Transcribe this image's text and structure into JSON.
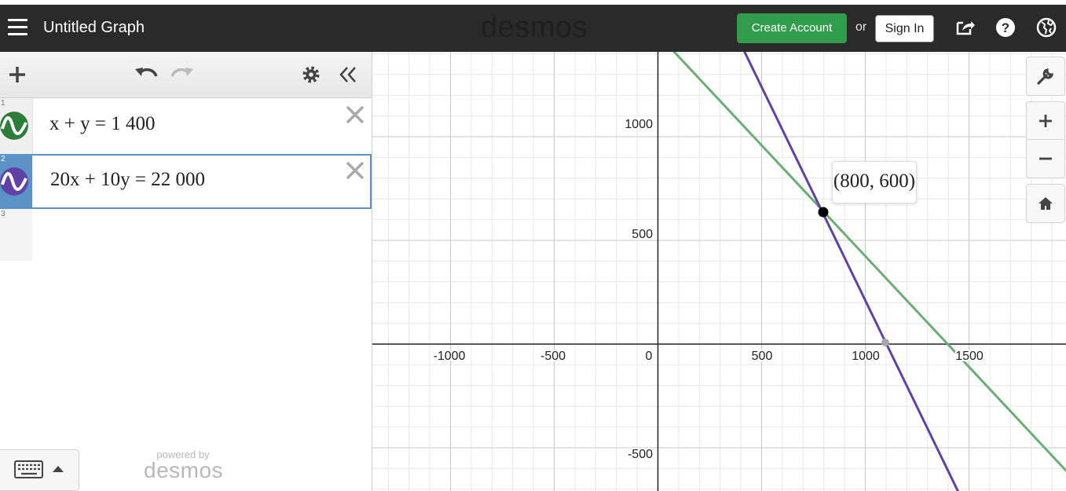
{
  "header": {
    "title": "Untitled Graph",
    "logo": "desmos",
    "create_account": "Create Account",
    "or": "or",
    "sign_in": "Sign In",
    "icons": [
      "share-icon",
      "help-icon",
      "globe-icon"
    ]
  },
  "toolbar": {
    "icons": [
      "add-icon",
      "undo-icon",
      "redo-icon",
      "settings-icon",
      "collapse-icon"
    ]
  },
  "expressions": [
    {
      "num": "1",
      "latex": "x + y = 1 400",
      "color": "#2d7d3a",
      "selected": false
    },
    {
      "num": "2",
      "latex": "20x + 10y = 22 000",
      "color": "#6042a6",
      "selected": true
    },
    {
      "num": "3",
      "latex": "",
      "selected": false
    }
  ],
  "footer": {
    "powered_by": "powered by",
    "brand": "desmos"
  },
  "graph": {
    "x_ticks": [
      "-1000",
      "-500",
      "0",
      "500",
      "1000",
      "1500"
    ],
    "y_ticks": [
      "1000",
      "500",
      "-500"
    ],
    "intersection_label": "(800, 600)",
    "line1_color": "#6cad75",
    "line2_color": "#6042a6"
  },
  "graph_controls": [
    "wrench-icon",
    "zoom-in-icon",
    "zoom-out-icon",
    "home-icon"
  ]
}
